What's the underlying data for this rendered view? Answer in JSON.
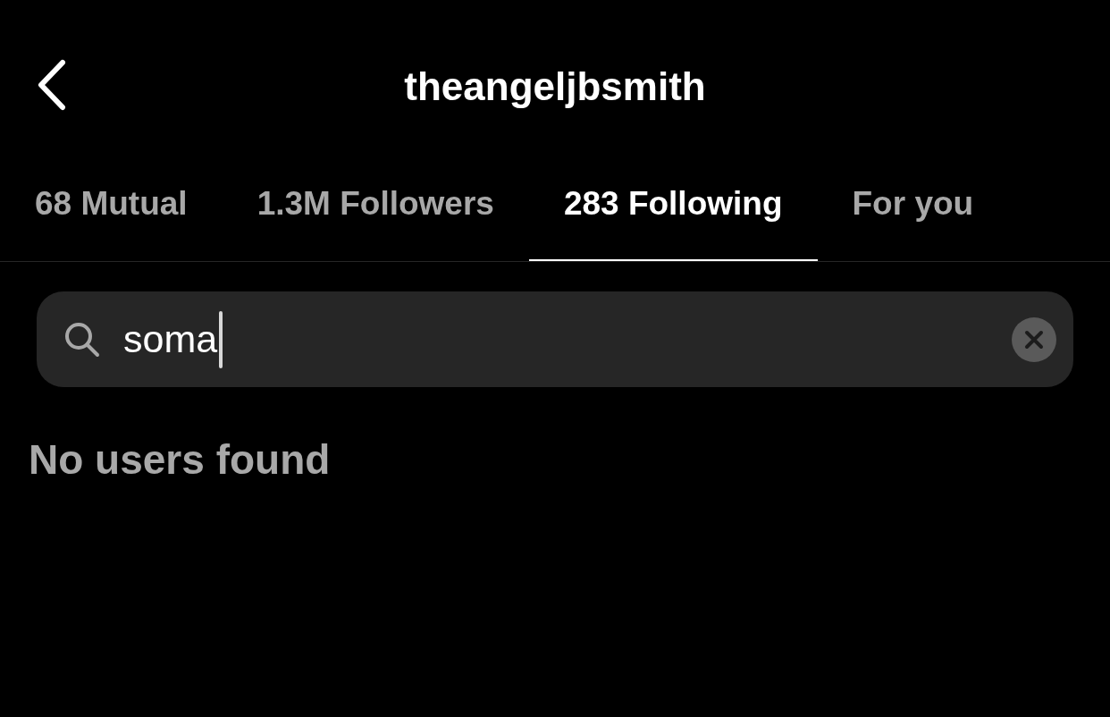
{
  "header": {
    "title": "theangeljbsmith"
  },
  "tabs": [
    {
      "label": "68 Mutual",
      "selected": false
    },
    {
      "label": "1.3M Followers",
      "selected": false
    },
    {
      "label": "283 Following",
      "selected": true
    },
    {
      "label": "For you",
      "selected": false
    }
  ],
  "search": {
    "value": "soma"
  },
  "message": "No users found"
}
